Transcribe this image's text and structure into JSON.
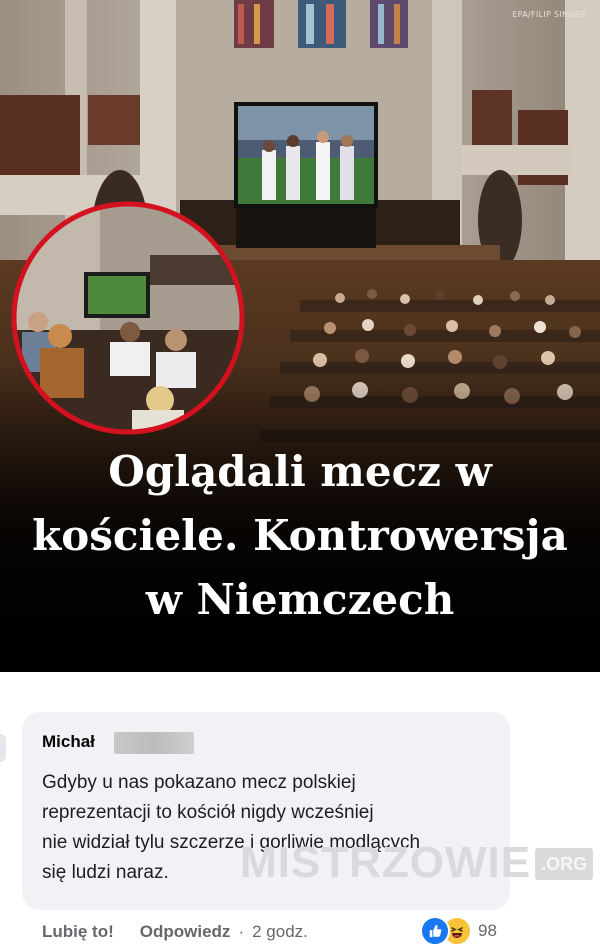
{
  "photo": {
    "credit": "EPA/FILIP SINGER",
    "headline_lines": [
      "Oglądali mecz w",
      "kościele. Kontrowersja",
      "w Niemczech"
    ]
  },
  "comment": {
    "author": "Michał",
    "text_lines": [
      "Gdyby u nas pokazano mecz polskiej",
      "reprezentacji to kościół nigdy wcześniej",
      "nie widział tylu szczerze i gorliwie modlących",
      "się ludzi naraz."
    ],
    "like_label": "Lubię to!",
    "reply_label": "Odpowiedz",
    "separator": "·",
    "time": "2 godz.",
    "reaction_icons": [
      "like-icon",
      "haha-icon"
    ],
    "reaction_count": "98"
  },
  "watermark": {
    "main": "MISTRZOWIE",
    "suffix": ".ORG"
  },
  "colors": {
    "headline_bg": "#000000",
    "bubble_bg": "#f0f2f5",
    "like_blue": "#1877f2",
    "haha_yellow": "#f7c33b",
    "highlight_circle": "#d4111f"
  }
}
